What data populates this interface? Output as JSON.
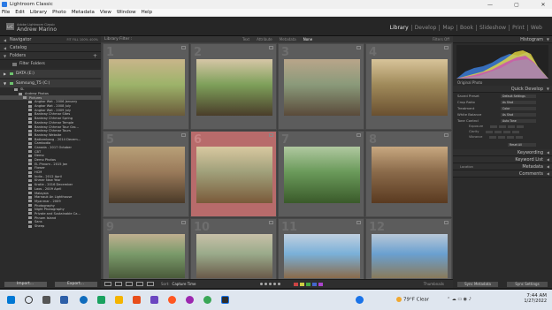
{
  "window": {
    "title": "Lightroom Classic",
    "min": "—",
    "max": "▢",
    "close": "✕"
  },
  "menu": [
    "File",
    "Edit",
    "Library",
    "Photo",
    "Metadata",
    "View",
    "Window",
    "Help"
  ],
  "identity": {
    "badge": "LrC",
    "small": "Adobe Lightroom Classic",
    "name": "Andrew Marino"
  },
  "modules": [
    "Library",
    "Develop",
    "Map",
    "Book",
    "Slideshow",
    "Print",
    "Web"
  ],
  "left_panel": {
    "navigator": {
      "label": "Navigator",
      "options": "FIT  FILL  100%  400%"
    },
    "catalog": {
      "label": "Catalog"
    },
    "folders": {
      "label": "Folders",
      "plus": "+"
    },
    "filter": {
      "label": "Filter Folders"
    },
    "volumes": [
      {
        "name": "DATA (E:)",
        "capacity": ""
      },
      {
        "name": "Samsung_T5 (C:)",
        "capacity": ""
      }
    ],
    "tree": [
      {
        "label": "SL",
        "count": ""
      },
      {
        "label": "Andrew Photos",
        "count": ""
      },
      {
        "label": "Pictures",
        "count": ""
      },
      {
        "label": "Angkor Wat - 2006 January",
        "count": ""
      },
      {
        "label": "Angkor Wat - 2008 July",
        "count": ""
      },
      {
        "label": "Angkor Wat - 2009 July",
        "count": ""
      },
      {
        "label": "Banteay Chhmar Sites",
        "count": ""
      },
      {
        "label": "Banteay Chhmar Spring",
        "count": ""
      },
      {
        "label": "Banteay Chhmar Temple",
        "count": ""
      },
      {
        "label": "Banteay Chhmar Tour Gro...",
        "count": ""
      },
      {
        "label": "Banteay Chhmar Tours",
        "count": ""
      },
      {
        "label": "Banteay Website",
        "count": ""
      },
      {
        "label": "Battambang - 2014 Decem...",
        "count": ""
      },
      {
        "label": "Cambodia",
        "count": ""
      },
      {
        "label": "Canada - 2017 October",
        "count": ""
      },
      {
        "label": "CBT",
        "count": ""
      },
      {
        "label": "Demo",
        "count": ""
      },
      {
        "label": "Demo Photos",
        "count": ""
      },
      {
        "label": "EL Phnom - 2015 Jan",
        "count": ""
      },
      {
        "label": "Flower",
        "count": ""
      },
      {
        "label": "HCM",
        "count": ""
      },
      {
        "label": "India - 2012 April",
        "count": ""
      },
      {
        "label": "Khmer New Year",
        "count": ""
      },
      {
        "label": "Kratie - 2016 December",
        "count": ""
      },
      {
        "label": "Laos - 2009 April",
        "count": ""
      },
      {
        "label": "Malaysia",
        "count": ""
      },
      {
        "label": "Marnauk An Lighthouse",
        "count": ""
      },
      {
        "label": "Myanmar - 2009",
        "count": ""
      },
      {
        "label": "Photography",
        "count": ""
      },
      {
        "label": "Night Photography",
        "count": ""
      },
      {
        "label": "Private and Sustainable Ca...",
        "count": ""
      },
      {
        "label": "Phnom Island",
        "count": ""
      },
      {
        "label": "Sans",
        "count": ""
      },
      {
        "label": "Sheep",
        "count": ""
      }
    ],
    "import_label": "Import...",
    "export_label": "Export..."
  },
  "center": {
    "title": "Library Filter :",
    "filter_tabs": [
      "Text",
      "Attribute",
      "Metadata",
      "None"
    ],
    "filter_off": "Filters Off",
    "cells": [
      {
        "num": "1"
      },
      {
        "num": "2"
      },
      {
        "num": "3"
      },
      {
        "num": "4"
      },
      {
        "num": "5"
      },
      {
        "num": "6"
      },
      {
        "num": "7"
      },
      {
        "num": "8"
      },
      {
        "num": "9"
      },
      {
        "num": "10"
      },
      {
        "num": "11"
      },
      {
        "num": "12"
      }
    ],
    "selected_index": 5,
    "toolbar": {
      "sort_label": "Sort:",
      "sort_value": "Capture Time",
      "thumbnails": "Thumbnails"
    }
  },
  "right_panel": {
    "histogram": "Histogram",
    "original_photo": "Original Photo",
    "quick_develop": "Quick Develop",
    "saved_preset": {
      "label": "Saved Preset",
      "value": "Default Settings"
    },
    "crop_ratio": {
      "label": "Crop Ratio",
      "value": "As Shot"
    },
    "treatment": {
      "label": "Treatment",
      "value": "Color"
    },
    "white_balance": {
      "label": "White Balance",
      "value": "As Shot"
    },
    "tone_control": {
      "label": "Tone Control",
      "value": "Auto Tone"
    },
    "tone_rows": [
      "Exposure",
      "Clarity",
      "Vibrance"
    ],
    "reset_all": "Reset All",
    "keywording": "Keywording",
    "keyword_list": "Keyword List",
    "metadata": {
      "label": "Metadata",
      "value": "Location"
    },
    "comments": "Comments",
    "sync_metadata": "Sync Metadata",
    "sync_settings": "Sync Settings"
  },
  "taskbar": {
    "weather": "79°F  Clear",
    "time": "7:44 AM",
    "date": "1/27/2022",
    "colors": [
      "#0078d4",
      "#e84e1b",
      "#1aa260",
      "#f4b400",
      "#6b46c1",
      "#ff5722",
      "#3aa757",
      "#2d2d2d",
      "#1a73e8",
      "#9c27b0"
    ]
  },
  "colors": {
    "accent_selected": "#b86b6b",
    "histogram_blue": "#3b7bd6",
    "histogram_yellow": "#e8d840",
    "histogram_magenta": "#c83ac8"
  }
}
